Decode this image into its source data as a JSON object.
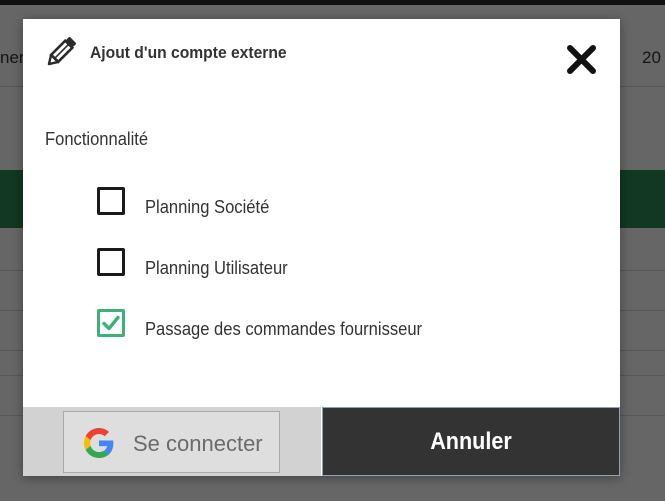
{
  "background": {
    "header_left_text": "ner",
    "header_right_text": "20"
  },
  "modal": {
    "title": "Ajout d'un compte externe",
    "section_label": "Fonctionnalité",
    "options": [
      {
        "label": "Planning Société",
        "checked": false
      },
      {
        "label": "Planning Utilisateur",
        "checked": false
      },
      {
        "label": "Passage des commandes fournisseur",
        "checked": true
      }
    ],
    "google_button_label": "Se connecter",
    "cancel_label": "Annuler"
  },
  "icons": {
    "title": "pencil-icon",
    "close": "close-icon",
    "checkbox_checked": "checkmark-icon",
    "google": "google-icon"
  },
  "colors": {
    "accent_green": "#2e8b57",
    "checkbox_checked": "#3fb07a",
    "cancel_background": "#333333",
    "footer_left_background": "#d2d2d2"
  }
}
